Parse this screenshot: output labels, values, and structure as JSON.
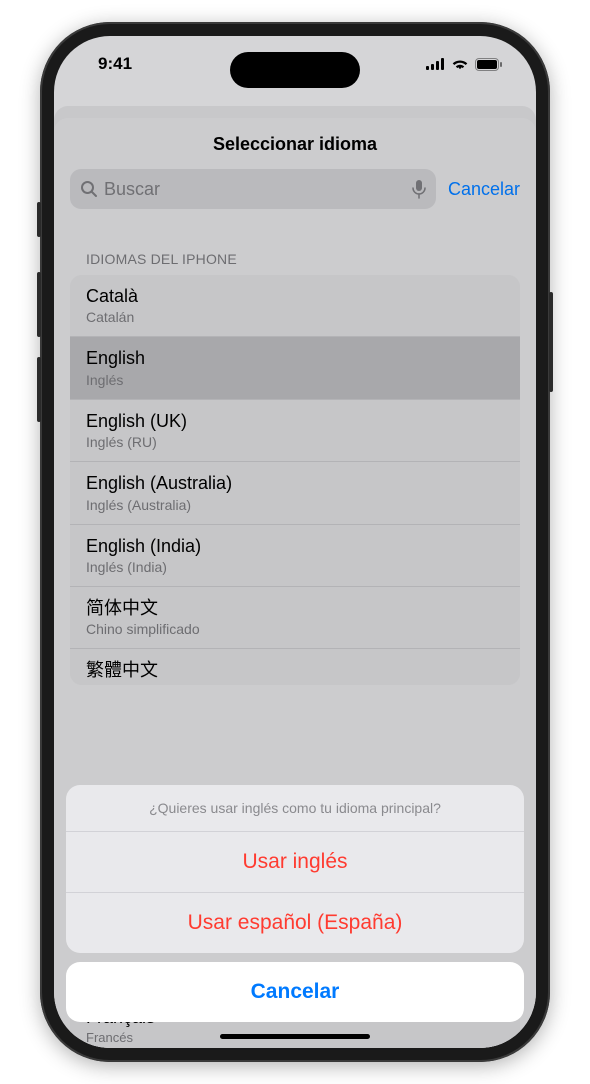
{
  "status": {
    "time": "9:41"
  },
  "header": {
    "title": "Seleccionar idioma",
    "search_placeholder": "Buscar",
    "cancel_label": "Cancelar"
  },
  "section_header": "IDIOMAS DEL IPHONE",
  "languages": [
    {
      "name": "Català",
      "subtitle": "Catalán",
      "selected": false
    },
    {
      "name": "English",
      "subtitle": "Inglés",
      "selected": true
    },
    {
      "name": "English (UK)",
      "subtitle": "Inglés (RU)",
      "selected": false
    },
    {
      "name": "English (Australia)",
      "subtitle": "Inglés (Australia)",
      "selected": false
    },
    {
      "name": "English (India)",
      "subtitle": "Inglés (India)",
      "selected": false
    },
    {
      "name": "简体中文",
      "subtitle": "Chino simplificado",
      "selected": false
    },
    {
      "name": "繁體中文",
      "subtitle": "",
      "selected": false
    }
  ],
  "bottom_peek": {
    "name": "Français",
    "subtitle": "Francés"
  },
  "action_sheet": {
    "prompt": "¿Quieres usar inglés como tu idioma principal?",
    "options": [
      "Usar inglés",
      "Usar español (España)"
    ],
    "cancel": "Cancelar"
  }
}
